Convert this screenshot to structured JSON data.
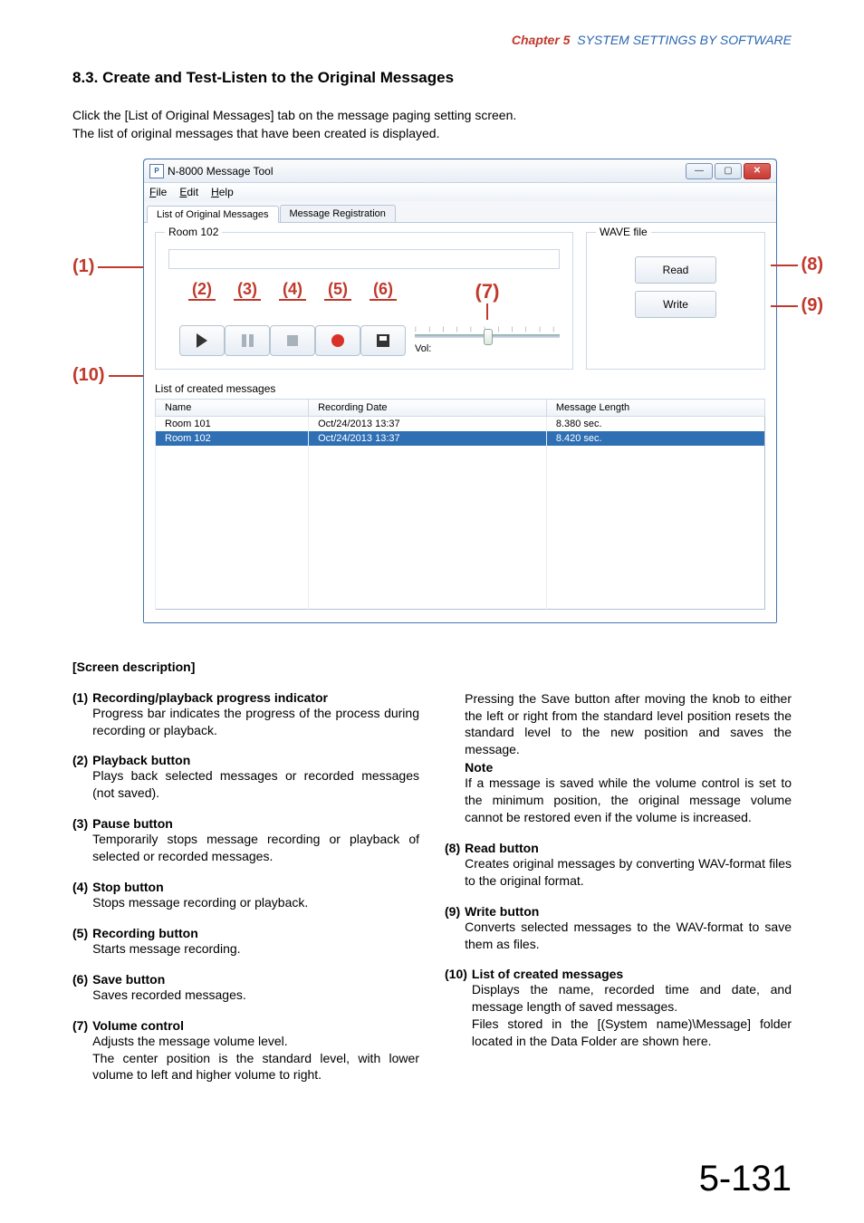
{
  "header": {
    "chapter": "Chapter 5",
    "title": "SYSTEM SETTINGS BY SOFTWARE"
  },
  "section_title": "8.3. Create and Test-Listen to the Original Messages",
  "intro_1": "Click the [List of Original Messages] tab on the message paging setting screen.",
  "intro_2": "The list of original messages that have been created is displayed.",
  "annos": {
    "a1": "(1)",
    "a2": "(2)",
    "a3": "(3)",
    "a4": "(4)",
    "a5": "(5)",
    "a6": "(6)",
    "a7": "(7)",
    "a8": "(8)",
    "a9": "(9)",
    "a10": "(10)"
  },
  "win": {
    "title": "N-8000 Message Tool",
    "menu": {
      "file": "File",
      "edit": "Edit",
      "help": "Help"
    },
    "tabs": {
      "t1": "List of Original Messages",
      "t2": "Message Registration"
    },
    "group_label": "Room 102",
    "vol_label": "Vol:",
    "wave_group": "WAVE file",
    "read_btn": "Read",
    "write_btn": "Write",
    "list_title": "List of created messages",
    "cols": {
      "name": "Name",
      "date": "Recording Date",
      "len": "Message Length"
    },
    "rows": [
      {
        "name": "Room 101",
        "date": "Oct/24/2013 13:37",
        "len": "8.380 sec."
      },
      {
        "name": "Room 102",
        "date": "Oct/24/2013 13:37",
        "len": "8.420 sec."
      }
    ]
  },
  "desc_heading": "[Screen description]",
  "left": {
    "i1": {
      "n": "(1)",
      "t": "Recording/playback progress indicator",
      "b": "Progress bar indicates the progress of the process during recording or playback."
    },
    "i2": {
      "n": "(2)",
      "t": "Playback button",
      "b": "Plays back selected messages or recorded messages (not saved)."
    },
    "i3": {
      "n": "(3)",
      "t": "Pause button",
      "b": "Temporarily stops message recording or playback of selected or recorded messages."
    },
    "i4": {
      "n": "(4)",
      "t": "Stop button",
      "b": "Stops message recording or playback."
    },
    "i5": {
      "n": "(5)",
      "t": "Recording button",
      "b": "Starts message recording."
    },
    "i6": {
      "n": "(6)",
      "t": "Save button",
      "b": "Saves recorded messages."
    },
    "i7": {
      "n": "(7)",
      "t": "Volume control",
      "b": "Adjusts the message volume level.",
      "b2": "The center position is the standard level, with lower volume to left and higher volume to right."
    }
  },
  "right": {
    "cont1": "Pressing the Save button after moving the knob to either the left or right from the standard level position resets the standard level to the new position and saves the message.",
    "note_h": "Note",
    "note_b": "If a message is saved while the volume control is set to the minimum position, the original message volume cannot be restored even if the volume is increased.",
    "i8": {
      "n": "(8)",
      "t": "Read button",
      "b": "Creates original messages by converting WAV-format files to the  original format."
    },
    "i9": {
      "n": "(9)",
      "t": "Write button",
      "b": "Converts selected messages to the WAV-format to save them as files."
    },
    "i10": {
      "n": "(10)",
      "t": "List of created messages",
      "b": "Displays the name, recorded time and date, and message length of saved messages.",
      "b2": "Files stored in the [(System name)\\Message] folder located in the Data Folder are shown here."
    }
  },
  "page": "5-131"
}
